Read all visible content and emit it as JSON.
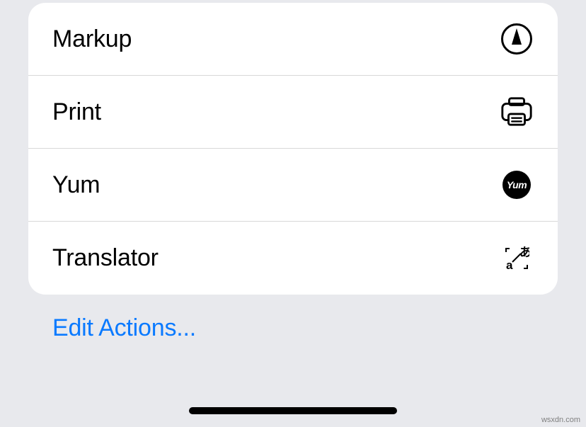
{
  "actions": [
    {
      "label": "Markup",
      "icon": "markup-icon"
    },
    {
      "label": "Print",
      "icon": "print-icon"
    },
    {
      "label": "Yum",
      "icon": "yum-icon"
    },
    {
      "label": "Translator",
      "icon": "translator-icon"
    }
  ],
  "editActions": "Edit Actions...",
  "watermark": "wsxdn.com",
  "yumText": "Yum"
}
